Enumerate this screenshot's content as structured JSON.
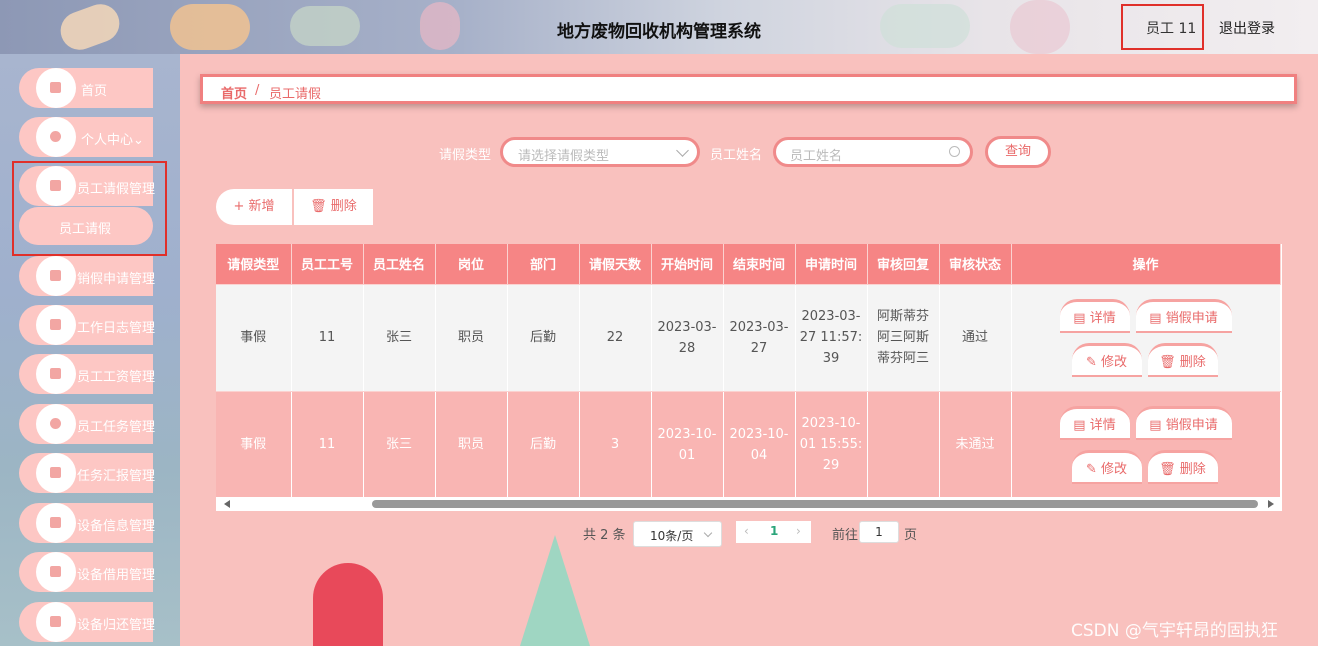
{
  "header": {
    "title": "地方废物回收机构管理系统",
    "user": "员工 11",
    "logout": "退出登录"
  },
  "sidebar": {
    "items": [
      {
        "label": "首页",
        "icon": "home-icon"
      },
      {
        "label": "个人中心",
        "icon": "user-icon"
      },
      {
        "label": "员工请假管理",
        "icon": "grid-icon"
      },
      {
        "label": "销假申请管理",
        "icon": "list-icon"
      },
      {
        "label": "工作日志管理",
        "icon": "grid-icon"
      },
      {
        "label": "员工工资管理",
        "icon": "grid-icon"
      },
      {
        "label": "员工任务管理",
        "icon": "user-icon"
      },
      {
        "label": "任务汇报管理",
        "icon": "grid-icon"
      },
      {
        "label": "设备信息管理",
        "icon": "monitor-icon"
      },
      {
        "label": "设备借用管理",
        "icon": "clipboard-icon"
      },
      {
        "label": "设备归还管理",
        "icon": "grid-icon"
      }
    ],
    "sub_item": "员工请假",
    "personal_chevron": "⌄"
  },
  "breadcrumb": {
    "home": "首页",
    "separator": "/",
    "current": "员工请假"
  },
  "filters": {
    "type_label": "请假类型",
    "type_placeholder": "请选择请假类型",
    "name_label": "员工姓名",
    "name_placeholder": "员工姓名",
    "query": "查询"
  },
  "actions": {
    "add": "+ 新增",
    "delete": "🗑 删除"
  },
  "table": {
    "columns": [
      "请假类型",
      "员工工号",
      "员工姓名",
      "岗位",
      "部门",
      "请假天数",
      "开始时间",
      "结束时间",
      "申请时间",
      "审核回复",
      "审核状态",
      "操作"
    ],
    "rows": [
      {
        "type": "事假",
        "id": "11",
        "name": "张三",
        "post": "职员",
        "dept": "后勤",
        "days": "22",
        "start": "2023-03-28",
        "end": "2023-03-27",
        "apply": "2023-03-27 11:57:39",
        "reply": "阿斯蒂芬阿三阿斯蒂芬阿三",
        "status": "通过"
      },
      {
        "type": "事假",
        "id": "11",
        "name": "张三",
        "post": "职员",
        "dept": "后勤",
        "days": "3",
        "start": "2023-10-01",
        "end": "2023-10-04",
        "apply": "2023-10-01 15:55:29",
        "reply": "",
        "status": "未通过"
      }
    ],
    "op_buttons": {
      "detail": "▤ 详情",
      "cancel": "▤ 销假申请",
      "edit": "✎ 修改",
      "delete": "🗑 删除"
    }
  },
  "pagination": {
    "total": "共 2 条",
    "page_size": "10条/页",
    "current": "1",
    "goto_label": "前往",
    "goto_value": "1",
    "page_unit": "页"
  },
  "watermark": "CSDN @气宇轩昂的固执狂",
  "colors": {
    "accent": "#f68585",
    "highlight": "#e0302a",
    "sidebar": "#fdc7c4"
  }
}
